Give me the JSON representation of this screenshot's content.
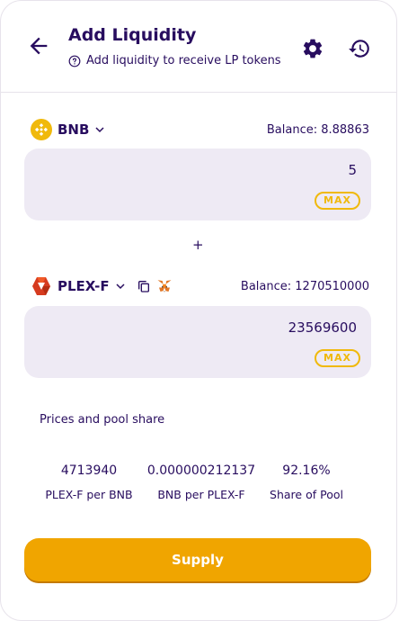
{
  "header": {
    "title": "Add Liquidity",
    "subtitle": "Add liquidity to receive LP tokens"
  },
  "token_a": {
    "symbol": "BNB",
    "balance_text": "Balance: 8.88863",
    "amount": "5",
    "max_label": "MAX"
  },
  "plus_symbol": "+",
  "token_b": {
    "symbol": "PLEX-F",
    "balance_text": "Balance: 1270510000",
    "amount": "23569600",
    "max_label": "MAX"
  },
  "prices": {
    "title": "Prices and pool share",
    "items": [
      {
        "value": "4713940",
        "label": "PLEX-F per BNB"
      },
      {
        "value": "0.000000212137",
        "label": "BNB per PLEX-F"
      },
      {
        "value": "92.16%",
        "label": "Share of Pool"
      }
    ]
  },
  "supply_label": "Supply",
  "colors": {
    "accent": "#f0a500",
    "text": "#280d5f",
    "input_bg": "#eeeaf4",
    "border": "#e7e3eb"
  },
  "icons": {
    "back": "arrow-left-icon",
    "help": "question-circle-icon",
    "settings": "gear-icon",
    "history": "history-icon",
    "bnb": "bnb-token-icon",
    "plex": "plex-token-icon",
    "copy": "copy-icon",
    "metamask": "metamask-icon"
  }
}
